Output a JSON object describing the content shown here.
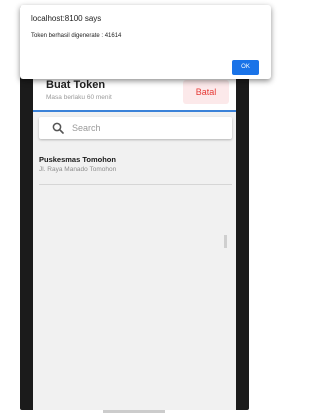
{
  "dialog": {
    "title": "localhost:8100 says",
    "message": "Token berhasil digenerate : 41614",
    "ok_label": "OK"
  },
  "header": {
    "title": "Buat Token",
    "subtitle": "Masa berlaku 60 menit",
    "cancel_label": "Batal"
  },
  "search": {
    "placeholder": "Search",
    "icon": "search-icon"
  },
  "list": {
    "items": [
      {
        "title": "Puskesmas Tomohon",
        "subtitle": "Jl. Raya Manado Tomohon"
      }
    ]
  },
  "colors": {
    "accent": "#3b82d8",
    "cancel": "#e53935",
    "dialog_button": "#1a73e8"
  }
}
